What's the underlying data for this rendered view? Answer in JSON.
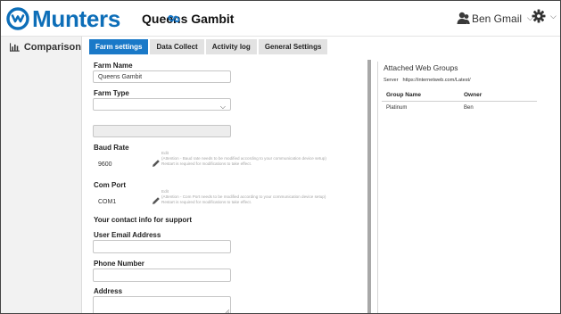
{
  "header": {
    "logo_text": "Munters",
    "farm_name": "Queens Gambit",
    "user_name": "Ben Gmail",
    "brand_color": "#0d6eb8"
  },
  "sidebar": {
    "items": [
      {
        "label": "Comparison",
        "icon": "bar-chart-icon"
      }
    ]
  },
  "tabs": [
    {
      "label": "Farm settings",
      "active": true
    },
    {
      "label": "Data Collect",
      "active": false
    },
    {
      "label": "Activity log",
      "active": false
    },
    {
      "label": "General Settings",
      "active": false
    }
  ],
  "form": {
    "farm_name_label": "Farm Name",
    "farm_name_value": "Queens Gambit",
    "farm_type_label": "Farm Type",
    "farm_type_value": "",
    "extra_field_value": "",
    "baud_rate_label": "Baud Rate",
    "baud_rate_value": "9600",
    "baud_note_line1": "Edit",
    "baud_note_line2": "(Attention - Baud rate needs to be modified according to your communication device setup)",
    "baud_note_line3": "Restart is required for modifications to take effect.",
    "com_port_label": "Com Port",
    "com_port_value": "COM1",
    "com_note_line1": "Edit",
    "com_note_line2": "(Attention - Com Port needs to be modified according to your communication device setup)",
    "com_note_line3": "Restart is required for modifications to take effect.",
    "contact_heading": "Your contact info for support",
    "email_label": "User Email Address",
    "email_value": "",
    "phone_label": "Phone Number",
    "phone_value": "",
    "address_label": "Address",
    "address_value": ""
  },
  "web_groups": {
    "title": "Attached Web Groups",
    "server_label": "Server",
    "server_url": "https://internetweb.com/Latest/",
    "columns": [
      "Group Name",
      "Owner"
    ],
    "rows": [
      {
        "group": "Platinum",
        "owner": "Ben"
      }
    ]
  }
}
